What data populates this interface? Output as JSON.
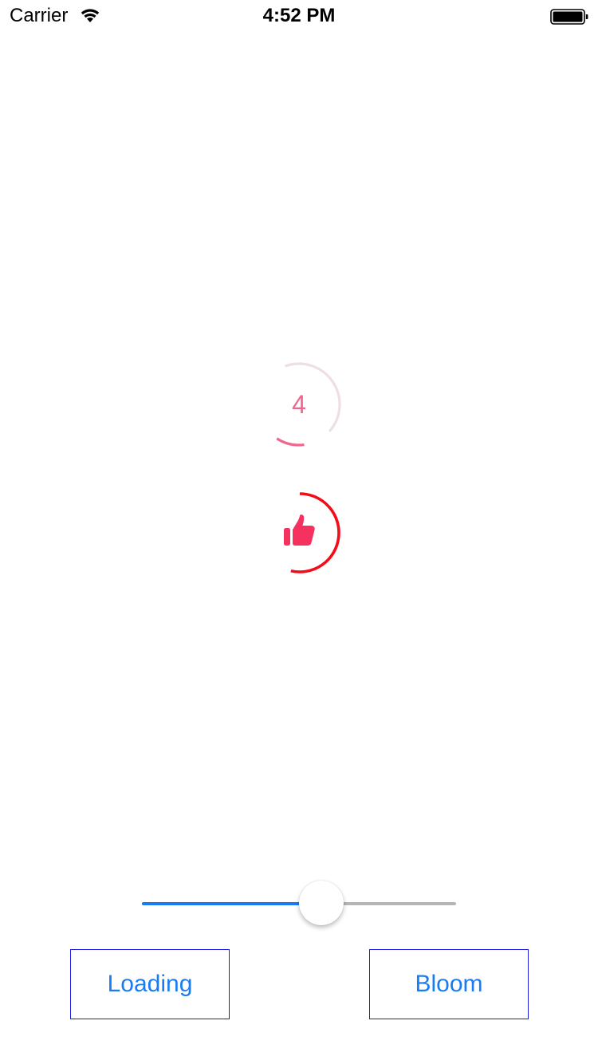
{
  "status_bar": {
    "carrier": "Carrier",
    "time": "4:52 PM",
    "wifi_icon": "wifi-icon",
    "battery_icon": "battery-full-icon"
  },
  "progress": {
    "value_text": "4",
    "fraction": 0.28,
    "color": "#f0668f",
    "track_color": "#eedfe3"
  },
  "like": {
    "icon": "thumbs-up-icon",
    "icon_color": "#f5325f",
    "ring_color": "#f20d18",
    "ring_fraction": 0.55
  },
  "slider": {
    "value": 0.57,
    "min_track_color": "#1a7cf4",
    "max_track_color": "#b6b6b6"
  },
  "buttons": {
    "loading_label": "Loading",
    "bloom_label": "Bloom",
    "text_color": "#1a7cf4",
    "border_color": "#1a1ae0"
  }
}
